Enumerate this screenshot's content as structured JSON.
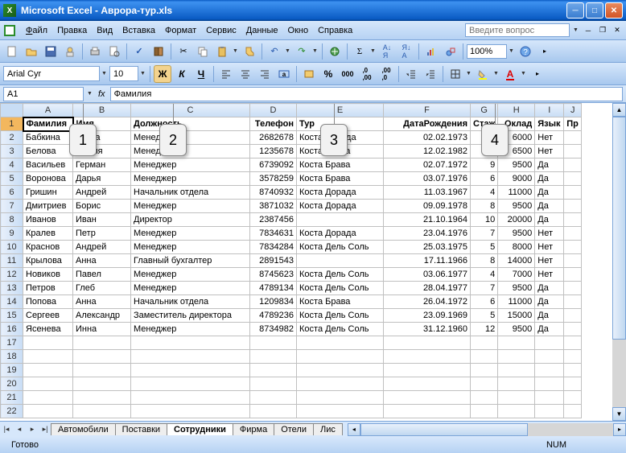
{
  "app": {
    "title": "Microsoft Excel - Аврора-тур.xls"
  },
  "menu": {
    "items": [
      "Файл",
      "Правка",
      "Вид",
      "Вставка",
      "Формат",
      "Сервис",
      "Данные",
      "Окно",
      "Справка"
    ],
    "help_placeholder": "Введите вопрос"
  },
  "toolbar": {
    "zoom": "100%"
  },
  "format": {
    "font_name": "Arial Cyr",
    "font_size": "10"
  },
  "formula": {
    "namebox": "A1",
    "fx": "Фамилия"
  },
  "callouts": [
    "1",
    "2",
    "3",
    "4"
  ],
  "columns": [
    "A",
    "B",
    "C",
    "D",
    "E",
    "F",
    "G",
    "H",
    "I"
  ],
  "headers": {
    "A": "Фамилия",
    "B": "Имя",
    "C": "Должность",
    "D": "Телефон",
    "E": "Тур",
    "F": "ДатаРождения",
    "G": "Стаж",
    "H": "Оклад",
    "I": "Язык",
    "J": "Пр"
  },
  "rows": [
    {
      "n": 2,
      "A": "Бабкина",
      "B": "Ольга",
      "C": "Менеджер",
      "D": "2682678",
      "E": "Коста Дорада",
      "F": "02.02.1973",
      "G": "3",
      "H": "6000",
      "I": "Нет"
    },
    {
      "n": 3,
      "A": "Белова",
      "B": "Мария",
      "C": "Менеджер",
      "D": "1235678",
      "E": "Коста Брава",
      "F": "12.02.1982",
      "G": "3",
      "H": "6500",
      "I": "Нет"
    },
    {
      "n": 4,
      "A": "Васильев",
      "B": "Герман",
      "C": "Менеджер",
      "D": "6739092",
      "E": "Коста Брава",
      "F": "02.07.1972",
      "G": "9",
      "H": "9500",
      "I": "Да"
    },
    {
      "n": 5,
      "A": "Воронова",
      "B": "Дарья",
      "C": "Менеджер",
      "D": "3578259",
      "E": "Коста Брава",
      "F": "03.07.1976",
      "G": "6",
      "H": "9000",
      "I": "Да"
    },
    {
      "n": 6,
      "A": "Гришин",
      "B": "Андрей",
      "C": "Начальник отдела",
      "D": "8740932",
      "E": "Коста Дорада",
      "F": "11.03.1967",
      "G": "4",
      "H": "11000",
      "I": "Да"
    },
    {
      "n": 7,
      "A": "Дмитриев",
      "B": "Борис",
      "C": "Менеджер",
      "D": "3871032",
      "E": "Коста Дорада",
      "F": "09.09.1978",
      "G": "8",
      "H": "9500",
      "I": "Да"
    },
    {
      "n": 8,
      "A": "Иванов",
      "B": "Иван",
      "C": "Директор",
      "D": "2387456",
      "E": "",
      "F": "21.10.1964",
      "G": "10",
      "H": "20000",
      "I": "Да"
    },
    {
      "n": 9,
      "A": "Кралев",
      "B": "Петр",
      "C": "Менеджер",
      "D": "7834631",
      "E": "Коста Дорада",
      "F": "23.04.1976",
      "G": "7",
      "H": "9500",
      "I": "Нет"
    },
    {
      "n": 10,
      "A": "Краснов",
      "B": "Андрей",
      "C": "Менеджер",
      "D": "7834284",
      "E": "Коста Дель Соль",
      "F": "25.03.1975",
      "G": "5",
      "H": "8000",
      "I": "Нет"
    },
    {
      "n": 11,
      "A": "Крылова",
      "B": "Анна",
      "C": "Главный бухгалтер",
      "D": "2891543",
      "E": "",
      "F": "17.11.1966",
      "G": "8",
      "H": "14000",
      "I": "Нет"
    },
    {
      "n": 12,
      "A": "Новиков",
      "B": "Павел",
      "C": "Менеджер",
      "D": "8745623",
      "E": "Коста Дель Соль",
      "F": "03.06.1977",
      "G": "4",
      "H": "7000",
      "I": "Нет"
    },
    {
      "n": 13,
      "A": "Петров",
      "B": "Глеб",
      "C": "Менеджер",
      "D": "4789134",
      "E": "Коста Дель Соль",
      "F": "28.04.1977",
      "G": "7",
      "H": "9500",
      "I": "Да"
    },
    {
      "n": 14,
      "A": "Попова",
      "B": "Анна",
      "C": "Начальник отдела",
      "D": "1209834",
      "E": "Коста Брава",
      "F": "26.04.1972",
      "G": "6",
      "H": "11000",
      "I": "Да"
    },
    {
      "n": 15,
      "A": "Сергеев",
      "B": "Александр",
      "C": "Заместитель директора",
      "D": "4789236",
      "E": "Коста Дель Соль",
      "F": "23.09.1969",
      "G": "5",
      "H": "15000",
      "I": "Да"
    },
    {
      "n": 16,
      "A": "Ясенева",
      "B": "Инна",
      "C": "Менеджер",
      "D": "8734982",
      "E": "Коста Дель Соль",
      "F": "31.12.1960",
      "G": "12",
      "H": "9500",
      "I": "Да"
    }
  ],
  "empty_rows": [
    17,
    18,
    19,
    20,
    21,
    22
  ],
  "sheets": {
    "tabs": [
      "Автомобили",
      "Поставки",
      "Сотрудники",
      "Фирма",
      "Отели",
      "Лис"
    ],
    "active": 2
  },
  "status": {
    "ready": "Готово",
    "num": "NUM"
  }
}
